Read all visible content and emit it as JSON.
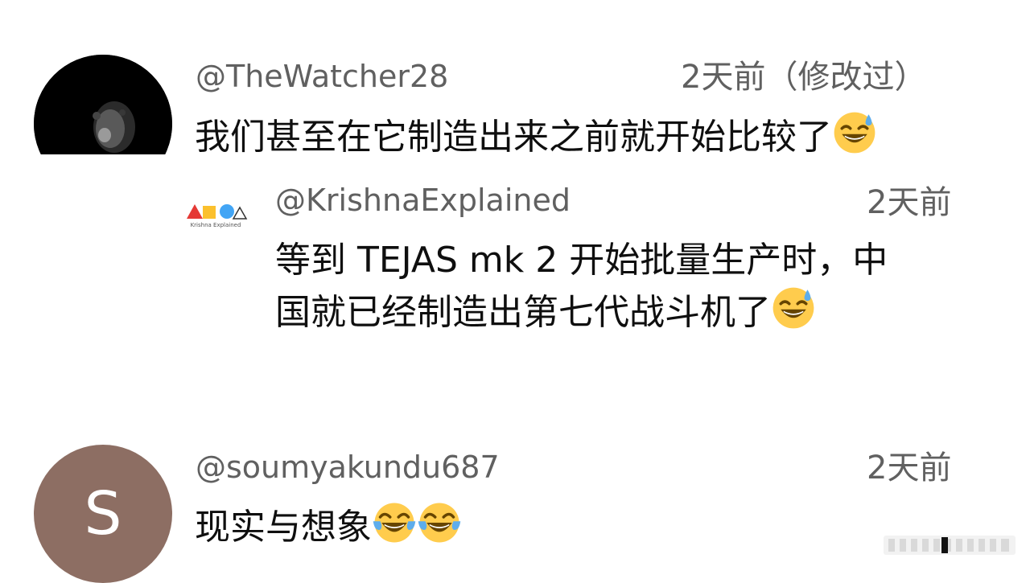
{
  "comments": [
    {
      "handle": "@TheWatcher28",
      "time": "2天前（修改过）",
      "text": "我们甚至在它制造出来之前就开始比较了",
      "emoji": "sweat-smile-emoji"
    },
    {
      "handle": "@KrishnaExplained",
      "time": "2天前",
      "text_line1": "等到 TEJAS mk 2 开始批量生产时，中",
      "text_line2": "国就已经制造出第七代战斗机了",
      "emoji": "sweat-smile-emoji",
      "avatar_caption": "Krishna Explained"
    },
    {
      "handle": "@soumyakundu687",
      "time": "2天前",
      "text": "现实与想象",
      "avatar_letter": "S",
      "emoji": "tears-of-joy-emoji"
    }
  ],
  "colors": {
    "handle_gray": "#606060",
    "text": "#0f0f0f",
    "avatar_s_bg": "#8d6e63",
    "emoji_yellow": "#ffcc4d",
    "sweat_blue": "#5dadec"
  }
}
